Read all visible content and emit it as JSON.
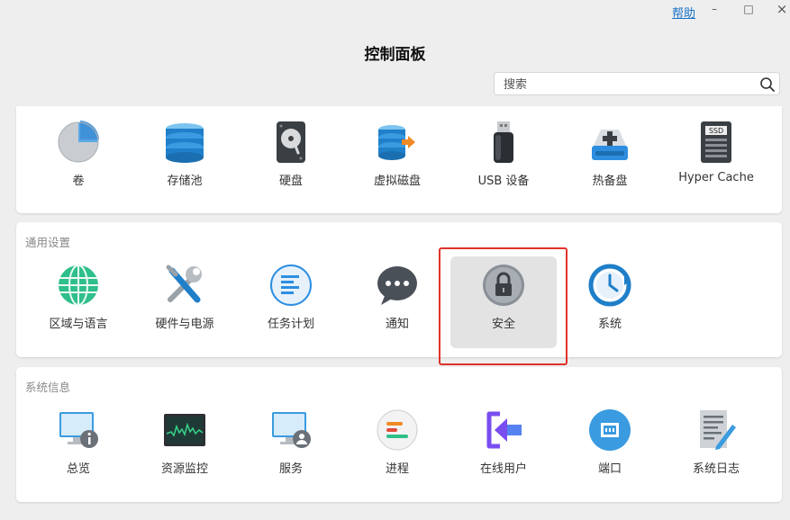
{
  "window": {
    "help_label": "帮助",
    "minimize_glyph": "–",
    "maximize_glyph": "□",
    "close_glyph": "×",
    "title": "控制面板"
  },
  "search": {
    "placeholder": "搜索",
    "value": ""
  },
  "sections": {
    "storage": {
      "label": "",
      "items": [
        {
          "label": "卷",
          "icon": "volume-pie-icon"
        },
        {
          "label": "存储池",
          "icon": "storage-pool-icon"
        },
        {
          "label": "硬盘",
          "icon": "hard-disk-icon"
        },
        {
          "label": "虚拟磁盘",
          "icon": "virtual-disk-icon"
        },
        {
          "label": "USB 设备",
          "icon": "usb-drive-icon"
        },
        {
          "label": "热备盘",
          "icon": "hot-spare-icon"
        },
        {
          "label": "Hyper Cache",
          "icon": "ssd-icon",
          "icon_text": "SSD"
        }
      ]
    },
    "general": {
      "label": "通用设置",
      "items": [
        {
          "label": "区域与语言",
          "icon": "globe-icon"
        },
        {
          "label": "硬件与电源",
          "icon": "tools-icon"
        },
        {
          "label": "任务计划",
          "icon": "task-list-icon"
        },
        {
          "label": "通知",
          "icon": "chat-bubble-icon"
        },
        {
          "label": "安全",
          "icon": "lock-icon",
          "selected": true
        },
        {
          "label": "系统",
          "icon": "system-clock-icon"
        }
      ]
    },
    "info": {
      "label": "系统信息",
      "items": [
        {
          "label": "总览",
          "icon": "overview-info-icon"
        },
        {
          "label": "资源监控",
          "icon": "resource-monitor-icon"
        },
        {
          "label": "服务",
          "icon": "service-user-icon"
        },
        {
          "label": "进程",
          "icon": "process-icon"
        },
        {
          "label": "在线用户",
          "icon": "online-users-icon"
        },
        {
          "label": "端口",
          "icon": "port-icon"
        },
        {
          "label": "系统日志",
          "icon": "system-log-icon"
        }
      ]
    }
  },
  "colors": {
    "highlight_border": "#e0322a",
    "selected_bg": "#e3e3e3",
    "link": "#1a73c8"
  }
}
